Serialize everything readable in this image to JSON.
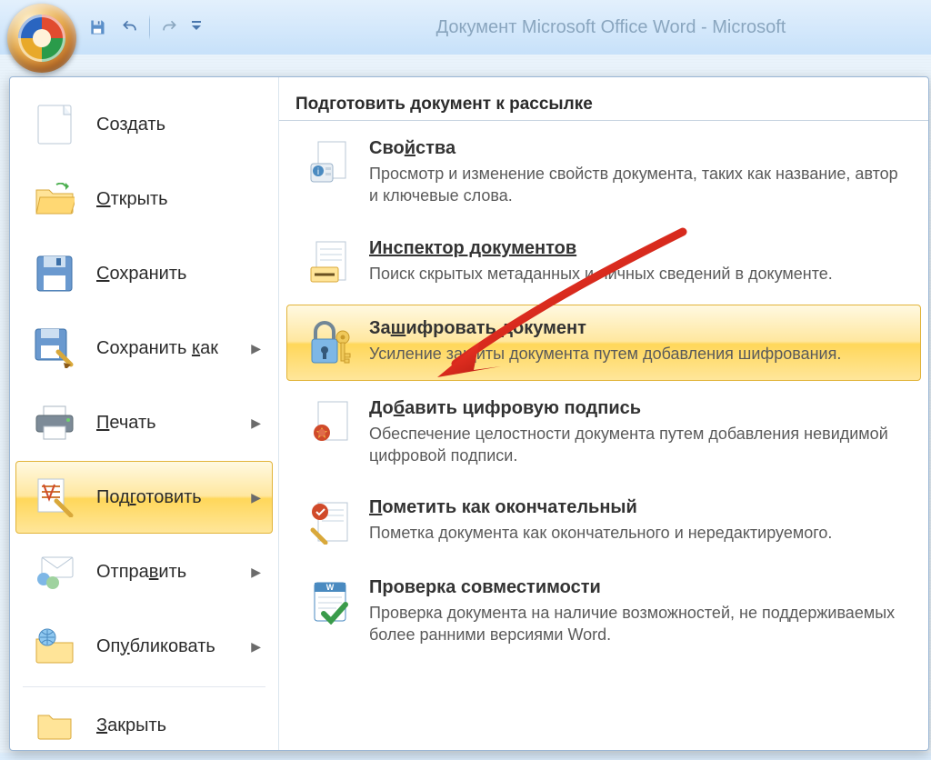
{
  "title": "Документ Microsoft Office Word - Microsoft ",
  "qat": {
    "save": "save-icon",
    "undo": "undo-icon",
    "redo": "redo-icon",
    "customize": "chevron-down-icon"
  },
  "left_menu": {
    "create": "Создать",
    "open": "Открыть",
    "save": "Сохранить",
    "save_as": "Сохранить как",
    "print": "Печать",
    "prepare": "Подготовить",
    "send": "Отправить",
    "publish": "Опубликовать",
    "close": "Закрыть"
  },
  "right": {
    "header": "Подготовить документ к рассылке",
    "items": [
      {
        "title": "Свойства",
        "desc": "Просмотр и изменение свойств документа, таких как название, автор и ключевые слова.",
        "underline_index": 3
      },
      {
        "title": "Инспектор документов",
        "desc": "Поиск скрытых метаданных и личных сведений в документе.",
        "underline_index": 0
      },
      {
        "title": "Зашифровать документ",
        "desc": "Усиление защиты документа путем добавления шифрования.",
        "underline_index": 2
      },
      {
        "title": "Добавить цифровую подпись",
        "desc": "Обеспечение целостности документа путем добавления невидимой цифровой подписи.",
        "underline_index": 2
      },
      {
        "title": "Пометить как окончательный",
        "desc": "Пометка документа как окончательного и нередактируемого.",
        "underline_index": 0
      },
      {
        "title": "Проверка совместимости",
        "desc": "Проверка документа на наличие возможностей, не поддерживаемых более ранними версиями Word."
      }
    ]
  }
}
